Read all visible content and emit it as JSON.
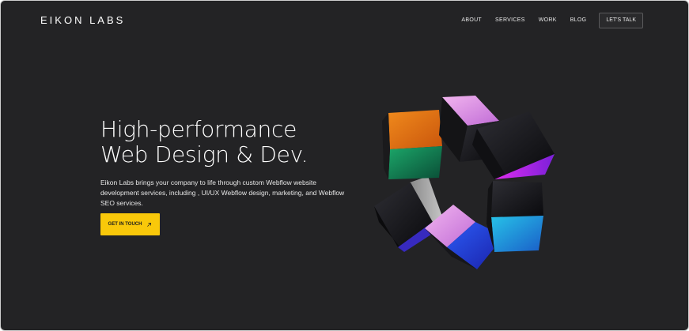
{
  "brand": {
    "logo_text": "EIKON LABS"
  },
  "nav": {
    "links": [
      "ABOUT",
      "SERVICES",
      "WORK",
      "BLOG"
    ],
    "cta_label": "LET'S TALK"
  },
  "hero": {
    "title_line_1": "High-performance",
    "title_line_2": "Web Design & Dev.",
    "description": "Eikon Labs brings your company to life through custom Webflow website development services, including , UI/UX Webflow design, marketing, and Webflow SEO services.",
    "cta_label": "GET IN TOUCH",
    "cta_icon": "arrow-up-right-icon"
  },
  "colors": {
    "background": "#232325",
    "accent": "#f9c80a",
    "text": "#ffffff"
  }
}
